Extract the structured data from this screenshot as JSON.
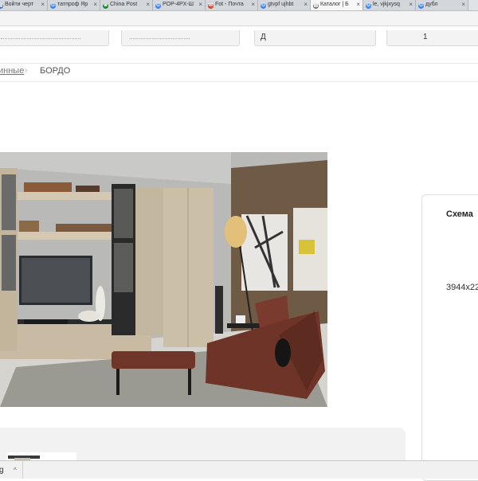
{
  "browser": {
    "tabs": [
      {
        "label": "Войти черт",
        "icon": "document-icon",
        "color": "#3b6cc7",
        "active": false
      },
      {
        "label": "татпроф Яр",
        "icon": "google-icon",
        "color": "#4285f4",
        "active": false
      },
      {
        "label": "China Post",
        "icon": "china-post-icon",
        "color": "#1a8a3a",
        "active": false
      },
      {
        "label": "POP-4PX-Ш",
        "icon": "google-icon",
        "color": "#4285f4",
        "active": false
      },
      {
        "label": "Fot - Почта",
        "icon": "mail-icon",
        "color": "#d34836",
        "active": false
      },
      {
        "label": "gtvpf ujhbt",
        "icon": "google-icon",
        "color": "#4285f4",
        "active": false
      },
      {
        "label": "Каталог | Б",
        "icon": "document-icon",
        "color": "#777777",
        "active": true
      },
      {
        "label": "le, vjkjxysq",
        "icon": "google-icon",
        "color": "#4285f4",
        "active": false
      },
      {
        "label": "дубл",
        "icon": "google-icon",
        "color": "#4285f4",
        "active": false
      }
    ],
    "close_glyph": "×"
  },
  "header": {
    "boxes": [
      {
        "name": "header-box-1",
        "text": "",
        "icon": ""
      },
      {
        "name": "header-box-2",
        "text": "",
        "icon": ""
      },
      {
        "name": "header-box-3",
        "text": "Д",
        "icon": ""
      },
      {
        "name": "header-box-4",
        "text": "",
        "icon": "1"
      }
    ]
  },
  "breadcrumb": {
    "link": "инные",
    "separator": "›",
    "current": "БОРДО"
  },
  "side_panel": {
    "title": "Схема",
    "dimensions": "3944x22"
  },
  "download_bar": {
    "item": "g",
    "caret": "^"
  },
  "colors": {
    "accent": "#333333",
    "panel_border": "#dedede",
    "strip_bg": "#f2f2f2"
  }
}
